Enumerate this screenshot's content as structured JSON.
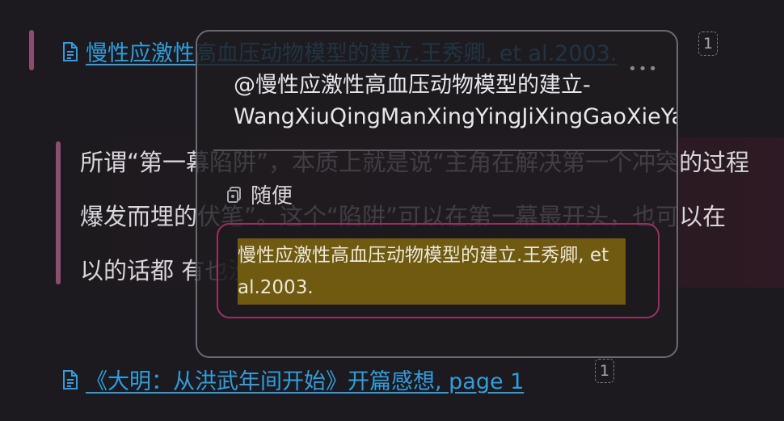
{
  "top_link": {
    "text": "慢性应激性高血压动物模型的建立.王秀卿, et al.2003.",
    "badge": "1"
  },
  "quote": {
    "lines": [
      "所谓“第一幕陷阱”，本质上就是说“主角在解决第一个冲突的过程",
      "爆发而埋的伏笔”。这个“陷阱”可以在第一幕最开头，也可以在",
      "以的话都 有也没问题。"
    ]
  },
  "popup": {
    "more_label": "•••",
    "title_line1": "@慢性应激性高血压动物模型的建立-",
    "title_line2": "WangXiuQingManXingYingJiXingGaoXieYaDongWu",
    "tag_label": "随便",
    "highlight": "慢性应激性高血压动物模型的建立.王秀卿, et al.2003."
  },
  "bottom_link": {
    "text": "《大明：从洪武年间开始》开篇感想, page 1",
    "badge": "1"
  },
  "colors": {
    "background": "#1c1a1e",
    "link": "#2f9fdc",
    "quote_bar": "#8a4d6f",
    "highlight_fill": "#6f5a10",
    "card_border": "#9b2f62"
  },
  "icons": [
    "document-icon",
    "more-icon",
    "tag-icon"
  ]
}
